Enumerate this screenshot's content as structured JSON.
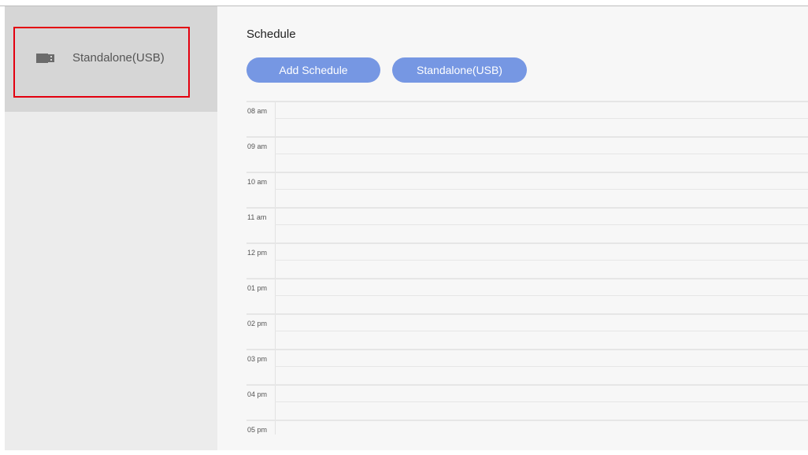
{
  "sidebar": {
    "items": [
      {
        "label": "Standalone(USB)",
        "icon": "usb-drive-icon",
        "selected": true
      }
    ]
  },
  "main": {
    "title": "Schedule",
    "buttons": {
      "add_schedule": "Add Schedule",
      "standalone_usb": "Standalone(USB)"
    },
    "timeline": {
      "hours": [
        "08 am",
        "09 am",
        "10 am",
        "11 am",
        "12 pm",
        "01 pm",
        "02 pm",
        "03 pm",
        "04 pm",
        "05 pm"
      ]
    }
  },
  "colors": {
    "button": "#7697e3",
    "sidebar_selected": "#d6d6d6",
    "highlight_box": "#e3000f"
  }
}
